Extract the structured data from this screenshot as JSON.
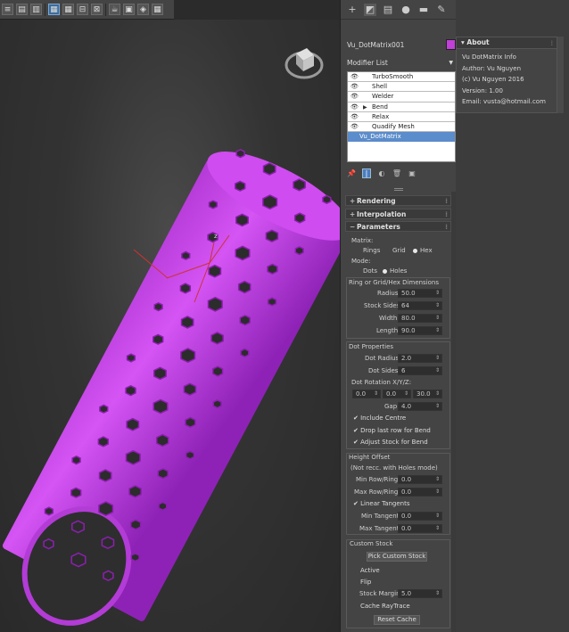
{
  "toolbar": {
    "buttons": [
      "menu-icon",
      "list-icon",
      "layout-icon",
      "layout-active-icon",
      "grid-icon",
      "frame-icon",
      "transform-icon",
      "teapot-icon",
      "image-icon",
      "render-icon",
      "render-setup-icon",
      "render-frame-icon"
    ]
  },
  "command_panel": {
    "tabs": [
      "create-icon",
      "modify-icon",
      "hierarchy-icon",
      "motion-icon",
      "display-icon",
      "utilities-icon"
    ],
    "object_name": "Vu_DotMatrix001",
    "object_color": "#c040d8",
    "modifier_list_label": "Modifier List",
    "stack": [
      {
        "label": "TurboSmooth",
        "has_arrow": false
      },
      {
        "label": "Shell",
        "has_arrow": false
      },
      {
        "label": "Welder",
        "has_arrow": false
      },
      {
        "label": "Bend",
        "has_arrow": true
      },
      {
        "label": "Relax",
        "has_arrow": false
      },
      {
        "label": "Quadify Mesh",
        "has_arrow": false
      }
    ],
    "base_object": "Vu_DotMatrix",
    "rollouts": {
      "rendering": "Rendering",
      "interpolation": "Interpolation",
      "parameters": "Parameters",
      "sign_collapsed": "+",
      "sign_expanded": "−"
    },
    "params": {
      "matrix_label": "Matrix:",
      "matrix_options": [
        "Rings",
        "Grid",
        "Hex"
      ],
      "matrix_selected": "Hex",
      "mode_label": "Mode:",
      "mode_options": [
        "Dots",
        "Holes"
      ],
      "mode_selected": "Holes",
      "dims_title": "Ring or Grid/Hex Dimensions",
      "radius_label": "Radius",
      "radius": "50.0",
      "stock_sides_label": "Stock Sides",
      "stock_sides": "64",
      "width_label": "Width",
      "width": "80.0",
      "length_label": "Length",
      "length": "90.0",
      "dot_props_title": "Dot Properties",
      "dot_radius_label": "Dot Radius",
      "dot_radius": "2.0",
      "dot_sides_label": "Dot Sides",
      "dot_sides": "6",
      "dot_rotation_label": "Dot Rotation X/Y/Z:",
      "rot_x": "0.0",
      "rot_y": "0.0",
      "rot_z": "30.0",
      "gap_label": "Gap",
      "gap": "4.0",
      "include_centre": "Include Centre",
      "drop_last_row": "Drop last row for Bend",
      "adjust_stock": "Adjust Stock for Bend",
      "height_offset_title": "Height Offset",
      "height_offset_note": "(Not recc. with Holes mode)",
      "min_row_label": "Min Row/Ring",
      "min_row": "0.0",
      "max_row_label": "Max Row/Ring",
      "max_row": "0.0",
      "linear_tangents": "Linear Tangents",
      "min_tangent_label": "Min Tangent",
      "min_tangent": "0.0",
      "max_tangent_label": "Max Tangent",
      "max_tangent": "0.0",
      "custom_stock_title": "Custom Stock",
      "pick_custom_stock": "Pick Custom Stock",
      "active": "Active",
      "flip": "Flip",
      "stock_margin_label": "Stock Margin",
      "stock_margin": "5.0",
      "cache_raytrace": "Cache RayTrace",
      "reset_cache": "Reset Cache",
      "check_mark": "✔"
    }
  },
  "about": {
    "header": "About",
    "lines": [
      "Vu DotMatrix Info",
      "Author: Vu Nguyen",
      "(c) Vu Nguyen 2016",
      "Version: 1.00",
      "Email: vusta@hotmail.com"
    ]
  },
  "viewport": {
    "gizmo_label": "z",
    "tube_color": "#c23fe3",
    "tube_shade": "#8d1fb0"
  }
}
